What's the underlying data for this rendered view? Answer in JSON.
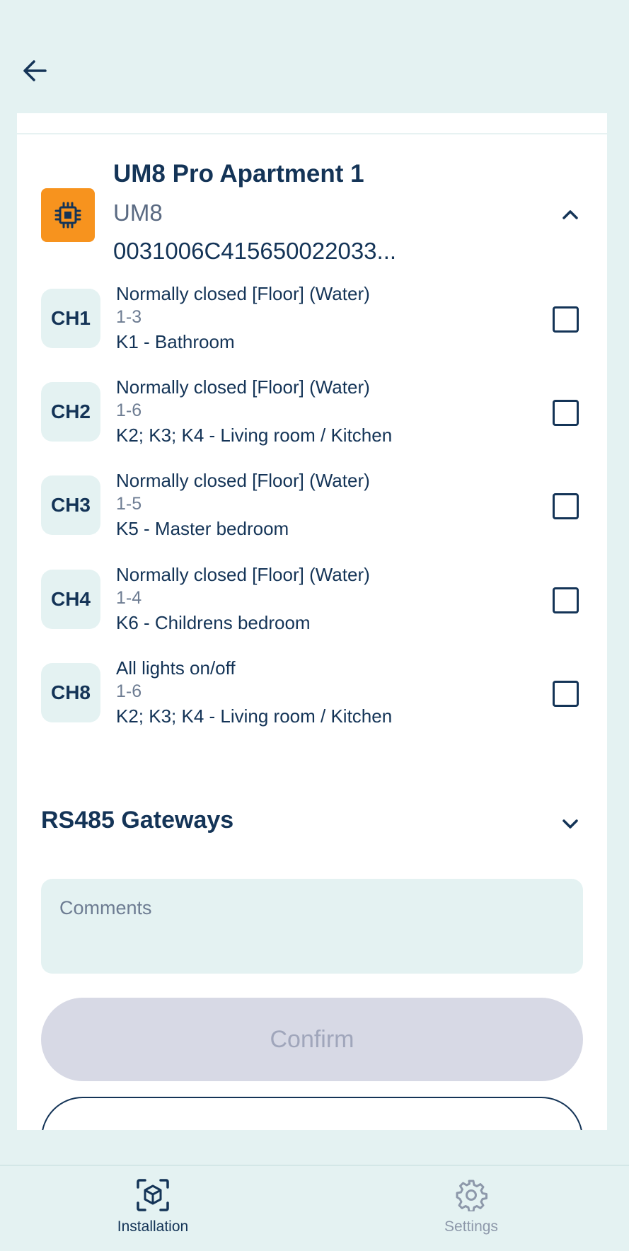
{
  "header": {
    "back_icon": "arrow-left-icon"
  },
  "device": {
    "icon": "chip-icon",
    "icon_color": "#f7931e",
    "name": "UM8 Pro Apartment 1",
    "type": "UM8",
    "serial": "0031006C415650022033..."
  },
  "channels": [
    {
      "badge": "CH1",
      "function": "Normally closed [Floor] (Water)",
      "range": "1-3",
      "rooms": "K1 - Bathroom",
      "checked": false
    },
    {
      "badge": "CH2",
      "function": "Normally closed [Floor] (Water)",
      "range": "1-6",
      "rooms": "K2; K3; K4 - Living room / Kitchen",
      "checked": false
    },
    {
      "badge": "CH3",
      "function": "Normally closed [Floor] (Water)",
      "range": "1-5",
      "rooms": "K5 - Master bedroom",
      "checked": false
    },
    {
      "badge": "CH4",
      "function": "Normally closed [Floor] (Water)",
      "range": "1-4",
      "rooms": "K6 - Childrens bedroom",
      "checked": false
    },
    {
      "badge": "CH8",
      "function": "All lights on/off",
      "range": "1-6",
      "rooms": "K2; K3; K4 - Living room / Kitchen",
      "checked": false
    }
  ],
  "gateways": {
    "title": "RS485 Gateways",
    "expanded": false
  },
  "comments": {
    "placeholder": "Comments",
    "value": ""
  },
  "confirm": {
    "label": "Confirm",
    "disabled": true
  },
  "tabs": [
    {
      "label": "Installation",
      "icon": "cube-scan-icon",
      "active": true
    },
    {
      "label": "Settings",
      "icon": "gear-icon",
      "active": false
    }
  ],
  "colors": {
    "background": "#e4f2f2",
    "primary": "#143457",
    "accent": "#f7931e",
    "disabled": "#d7d9e5"
  }
}
